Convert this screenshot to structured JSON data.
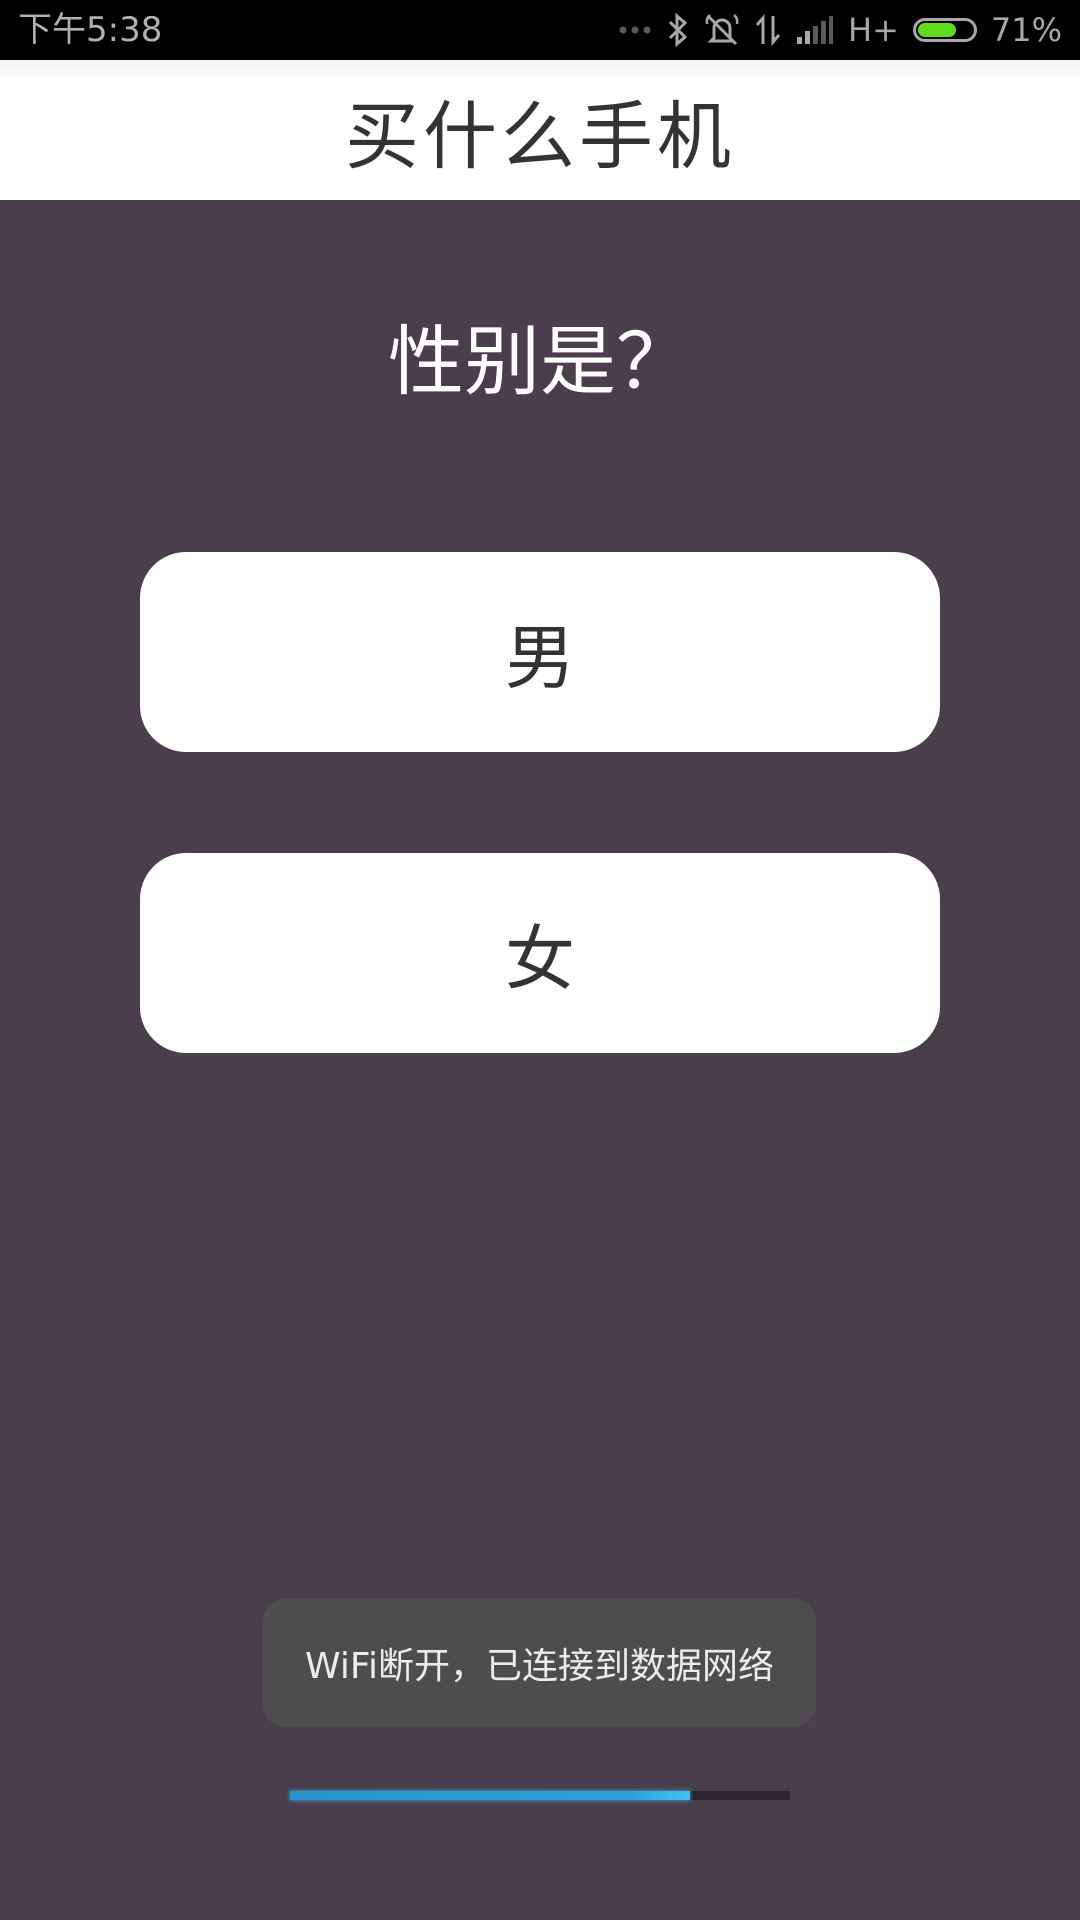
{
  "status_bar": {
    "time": "下午5:38",
    "network": "H+",
    "battery_percent": "71%",
    "battery_level": 0.71,
    "icons": [
      "more-dots-icon",
      "bluetooth-icon",
      "alarm-off-icon",
      "data-transfer-icon",
      "signal-icon"
    ]
  },
  "header": {
    "title": "买什么手机"
  },
  "question": {
    "text": "性别是？"
  },
  "options": {
    "male": "男",
    "female": "女"
  },
  "toast": {
    "text": "WiFi断开，已连接到数据网络"
  },
  "progress": {
    "value": 0.8
  },
  "colors": {
    "background": "#4a3d4c",
    "header_bg": "#ffffff",
    "button_bg": "#ffffff",
    "text_dark": "#333333",
    "toast_bg": "#4d4d4d",
    "progress_fill": "#2ea1da",
    "battery_fill": "#5ddb1c"
  }
}
